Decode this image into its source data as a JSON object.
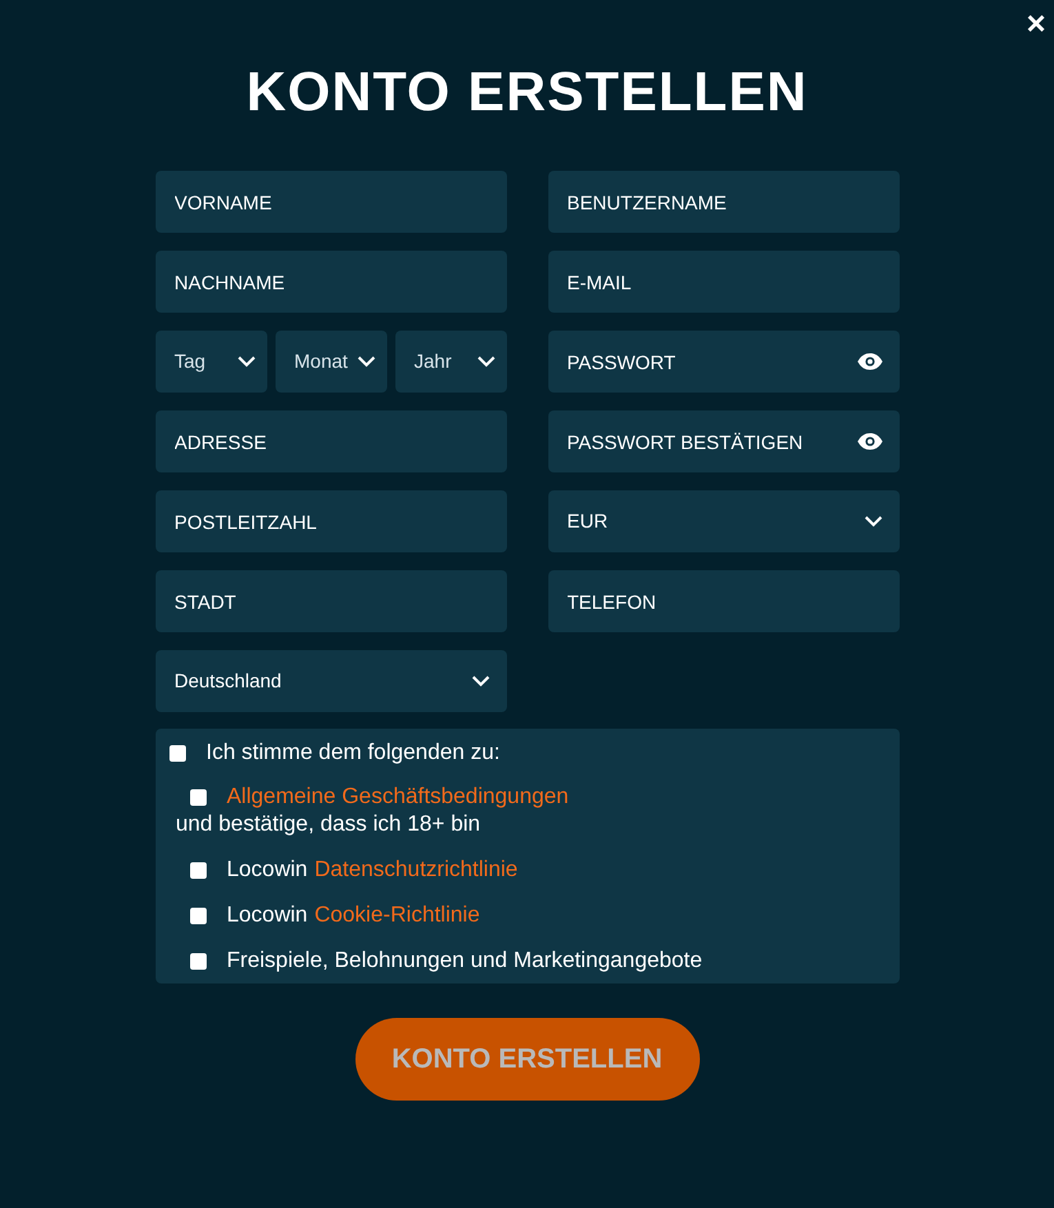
{
  "close": "×",
  "title": "KONTO ERSTELLEN",
  "left_fields": [
    {
      "kind": "text",
      "placeholder": "VORNAME"
    },
    {
      "kind": "text",
      "placeholder": "NACHNAME"
    },
    {
      "kind": "date",
      "parts": [
        "Tag",
        "Monat",
        "Jahr"
      ]
    },
    {
      "kind": "text",
      "placeholder": "ADRESSE"
    },
    {
      "kind": "text",
      "placeholder": "POSTLEITZAHL"
    },
    {
      "kind": "text",
      "placeholder": "STADT"
    },
    {
      "kind": "select",
      "value": "Deutschland"
    }
  ],
  "right_fields": [
    {
      "kind": "text",
      "placeholder": "BENUTZERNAME"
    },
    {
      "kind": "text",
      "placeholder": "E-MAIL"
    },
    {
      "kind": "password",
      "placeholder": "PASSWORT"
    },
    {
      "kind": "password",
      "placeholder": "PASSWORT BESTÄTIGEN"
    },
    {
      "kind": "select",
      "value": "EUR"
    },
    {
      "kind": "text",
      "placeholder": "TELEFON"
    }
  ],
  "consent": {
    "label": "Ich stimme dem folgenden zu:",
    "checked": false,
    "items": [
      {
        "link": "Allgemeine Geschäftsbedingungen",
        "note": "und bestätige, dass ich 18+ bin",
        "checked": false
      },
      {
        "prefix": "Locowin",
        "link": "Datenschutzrichtlinie",
        "checked": false
      },
      {
        "prefix": "Locowin",
        "link": "Cookie-Richtlinie",
        "checked": false
      },
      {
        "prefix": "Freispiele, Belohnungen und Marketingangebote",
        "checked": false
      }
    ]
  },
  "submit": "KONTO ERSTELLEN"
}
